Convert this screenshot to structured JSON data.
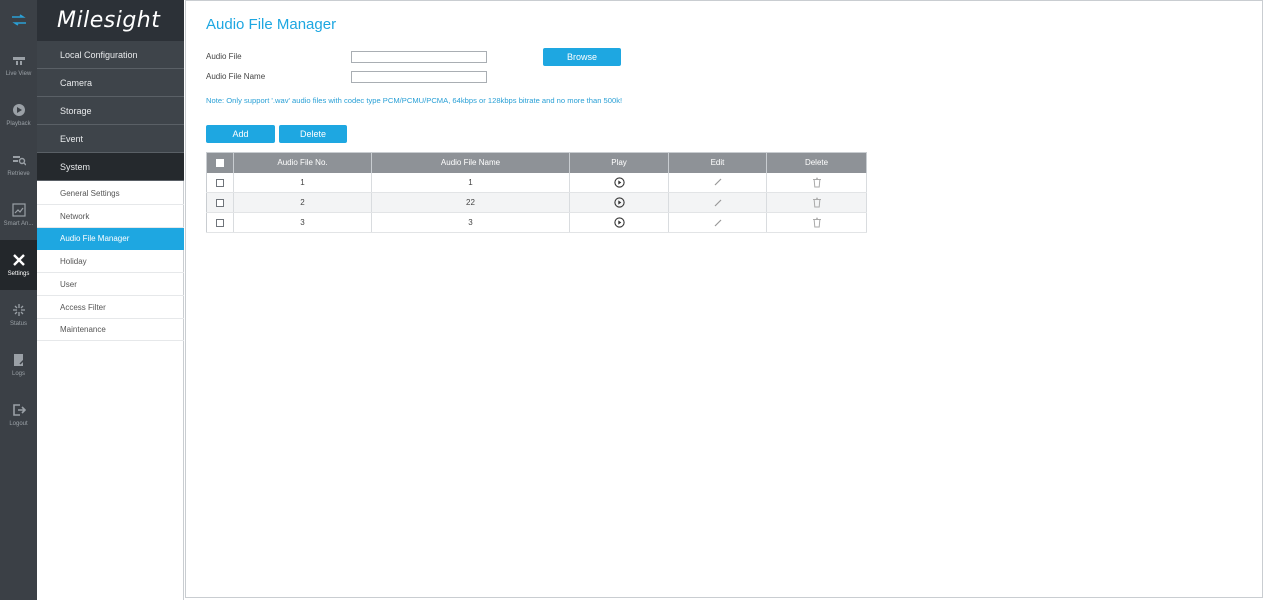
{
  "brand": "Milesight",
  "rail": [
    {
      "label": "",
      "icon": "swap-arrows-icon"
    },
    {
      "label": "Live View",
      "icon": "live-view-icon"
    },
    {
      "label": "Playback",
      "icon": "playback-icon"
    },
    {
      "label": "Retrieve",
      "icon": "retrieve-icon"
    },
    {
      "label": "Smart An...",
      "icon": "smart-analysis-icon"
    },
    {
      "label": "Settings",
      "icon": "settings-icon"
    },
    {
      "label": "Status",
      "icon": "status-icon"
    },
    {
      "label": "Logs",
      "icon": "logs-icon"
    },
    {
      "label": "Logout",
      "icon": "logout-icon"
    }
  ],
  "nav": {
    "categories": [
      "Local Configuration",
      "Camera",
      "Storage",
      "Event",
      "System"
    ],
    "subitems": [
      "General Settings",
      "Network",
      "Audio File Manager",
      "Holiday",
      "User",
      "Access Filter",
      "Maintenance"
    ]
  },
  "page": {
    "title": "Audio File Manager",
    "audio_file_label": "Audio File",
    "audio_file_name_label": "Audio File Name",
    "audio_file_value": "",
    "audio_file_name_value": "",
    "browse_label": "Browse",
    "note": "Note: Only support '.wav' audio files with codec type PCM/PCMU/PCMA, 64kbps or 128kbps bitrate and no more than 500k!",
    "add_label": "Add",
    "delete_label": "Delete"
  },
  "table": {
    "headers": [
      "Audio File No.",
      "Audio File Name",
      "Play",
      "Edit",
      "Delete"
    ],
    "rows": [
      {
        "no": "1",
        "name": "1"
      },
      {
        "no": "2",
        "name": "22"
      },
      {
        "no": "3",
        "name": "3"
      }
    ]
  },
  "colors": {
    "accent": "#1ea7e1",
    "rail_bg": "#3b4046",
    "nav_dark": "#25292d",
    "table_header": "#8e9297"
  }
}
